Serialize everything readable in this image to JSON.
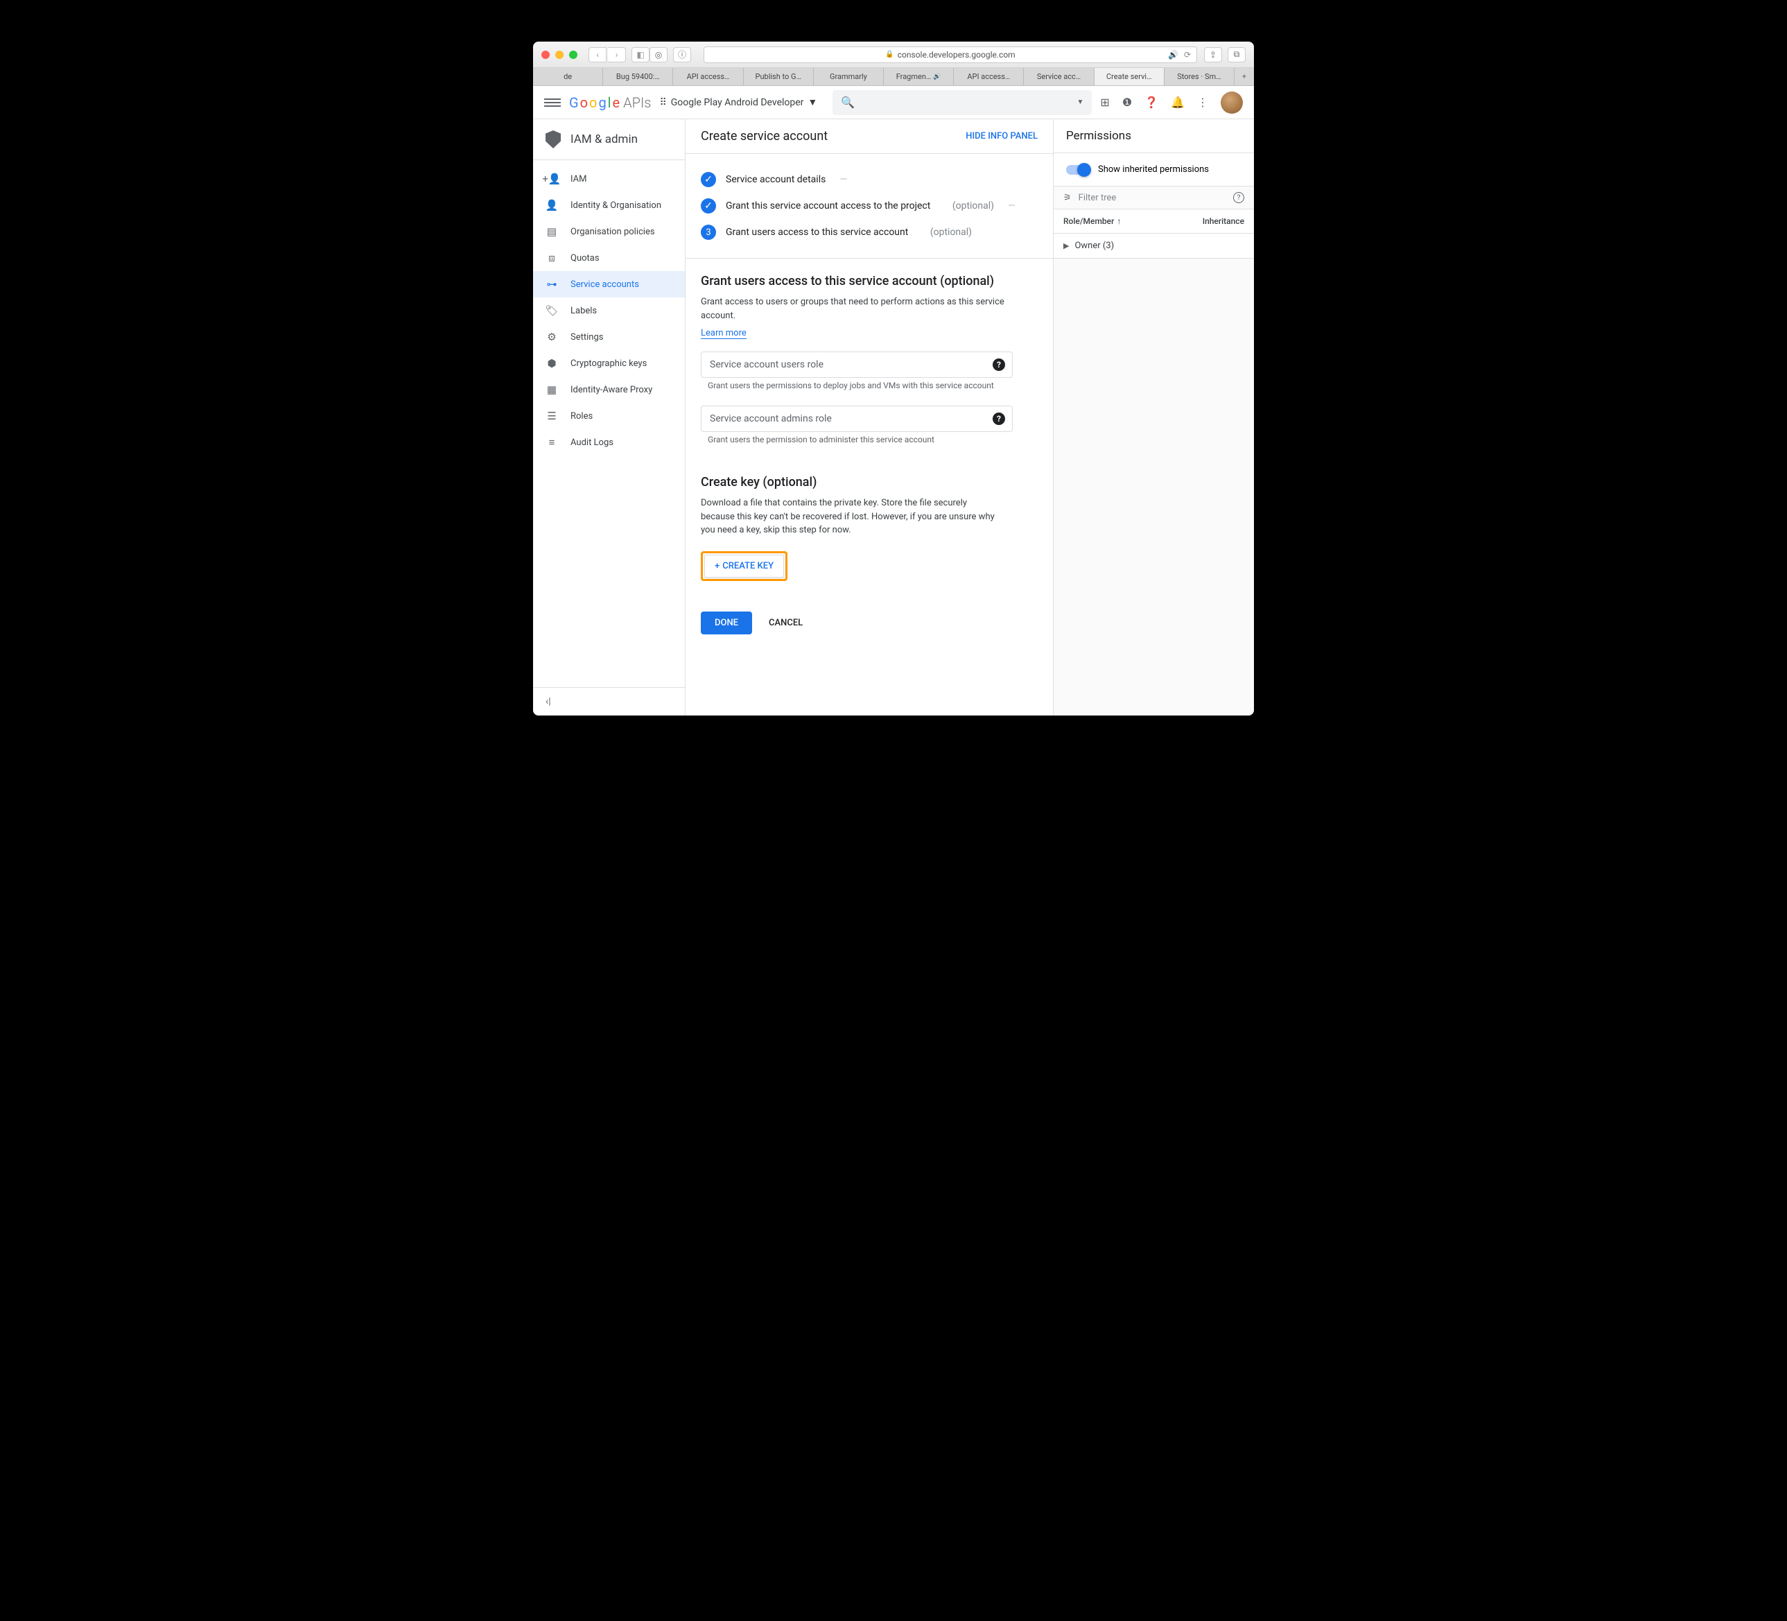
{
  "browser": {
    "url": "console.developers.google.com",
    "tabs": [
      "de",
      "Bug 59400:…",
      "API access…",
      "Publish to G…",
      "Grammarly",
      "Fragmen…",
      "API access…",
      "Service acc…",
      "Create servi…",
      "Stores · Sm…"
    ],
    "active_tab_index": 8
  },
  "header": {
    "logo_text": "Google",
    "logo_suffix": "APIs",
    "project_name": "Google Play Android Developer"
  },
  "sidebar": {
    "title": "IAM & admin",
    "items": [
      {
        "label": "IAM",
        "icon": "👥"
      },
      {
        "label": "Identity & Organisation",
        "icon": "◉"
      },
      {
        "label": "Organisation policies",
        "icon": "▤"
      },
      {
        "label": "Quotas",
        "icon": "⧈"
      },
      {
        "label": "Service accounts",
        "icon": "⊞",
        "active": true
      },
      {
        "label": "Labels",
        "icon": "🏷"
      },
      {
        "label": "Settings",
        "icon": "⚙"
      },
      {
        "label": "Cryptographic keys",
        "icon": "⬢"
      },
      {
        "label": "Identity-Aware Proxy",
        "icon": "▦"
      },
      {
        "label": "Roles",
        "icon": "▭"
      },
      {
        "label": "Audit Logs",
        "icon": "☰"
      }
    ]
  },
  "page": {
    "title": "Create service account",
    "hide_panel": "HIDE INFO PANEL",
    "steps": {
      "s1": "Service account details",
      "s2": "Grant this service account access to the project",
      "s3": "Grant users access to this service account",
      "optional": "(optional)"
    },
    "grant_section": {
      "title": "Grant users access to this service account (optional)",
      "desc": "Grant access to users or groups that need to perform actions as this service account.",
      "learn_more": "Learn more",
      "field1_placeholder": "Service account users role",
      "field1_hint": "Grant users the permissions to deploy jobs and VMs with this service account",
      "field2_placeholder": "Service account admins role",
      "field2_hint": "Grant users the permission to administer this service account"
    },
    "key_section": {
      "title": "Create key (optional)",
      "desc": "Download a file that contains the private key. Store the file securely because this key can't be recovered if lost. However, if you are unsure why you need a key, skip this step for now.",
      "button": "CREATE KEY"
    },
    "actions": {
      "done": "DONE",
      "cancel": "CANCEL"
    }
  },
  "permissions": {
    "title": "Permissions",
    "toggle_label": "Show inherited permissions",
    "filter_placeholder": "Filter tree",
    "col1": "Role/Member",
    "col2": "Inheritance",
    "row1": "Owner (3)"
  }
}
